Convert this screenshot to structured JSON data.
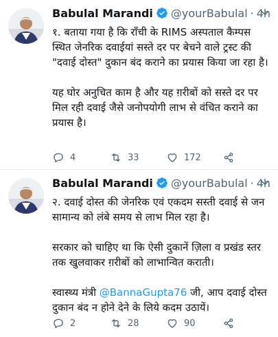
{
  "tweets": [
    {
      "name": "Babulal Marandi",
      "handle": "@yourBabulal",
      "dot": "·",
      "time": "4h",
      "paragraphs": [
        "१. बताया गया है कि राँची के RIMS अस्पताल कैम्पस स्थित जेनरिक दवाईयां सस्ते दर पर बेचने वाले ट्रस्ट की \"दवाई दोस्त\" दुकान बंद कराने का प्रयास किया जा रहा है।",
        "यह घोर अनुचित काम है और यह ग़रीबों को सस्ते दर पर मिल रही दवाई जैसे जनोपयोगी लाभ से वंचित कराने का प्रयास है।"
      ],
      "replies": "4",
      "retweets": "33",
      "likes": "172"
    },
    {
      "name": "Babulal Marandi",
      "handle": "@yourBabulal",
      "dot": "·",
      "time": "4h",
      "paragraphs": [
        "२. दवाई दोस्त की जेनरिक एवं एकदम सस्ती दवाई से जन सामान्य को लंबे समय से लाभ मिल रहा है।",
        "सरकार को चाहिए था कि ऐसी दुकानें ज़िला व प्रखंड स्तर तक खुलवाकर ग़रीबों को लाभान्वित कराती।"
      ],
      "last_para_prefix": "स्वास्थ्य मंत्री ",
      "mention": "@BannaGupta76",
      "last_para_suffix": " जी, आप दवाई दोस्त दुकान बंद न होने देने के लिये कदम उठायें।",
      "replies": "2",
      "retweets": "28",
      "likes": "90"
    }
  ],
  "colors": {
    "verified": "#1d9bf0",
    "mention": "#1d9bf0",
    "muted": "#536471",
    "divider": "#e6ecf0"
  },
  "icons": {
    "verified": "verified-badge-icon",
    "more": "chevron-down-icon",
    "reply": "reply-icon",
    "retweet": "retweet-icon",
    "like": "heart-icon",
    "share": "share-icon"
  }
}
